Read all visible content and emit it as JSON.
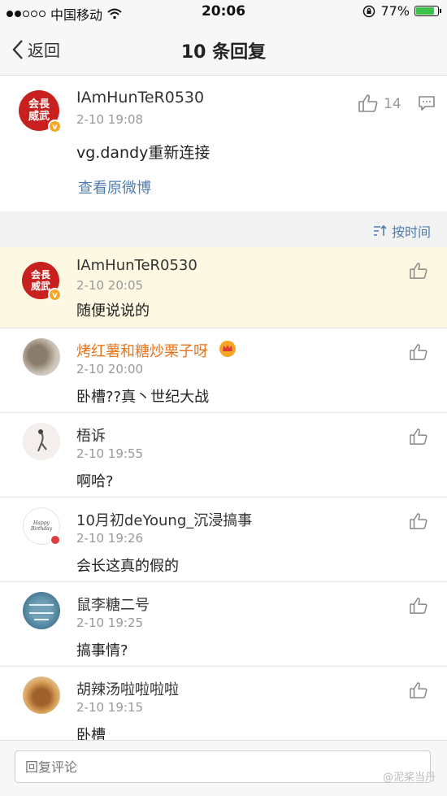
{
  "status_bar": {
    "carrier": "中国移动",
    "time": "20:06",
    "battery": "77%"
  },
  "nav": {
    "back_label": "返回",
    "title": "10 条回复"
  },
  "original": {
    "username": "IAmHunTeR0530",
    "avatar_text_1": "会長",
    "avatar_text_2": "威武",
    "time": "2-10 19:08",
    "text": "vg.dandy重新连接",
    "like_count": "14",
    "view_link": "查看原微博"
  },
  "sort": {
    "label": "按时间"
  },
  "comments": [
    {
      "username": "IAmHunTeR0530",
      "avatar_text_1": "会長",
      "avatar_text_2": "威武",
      "time": "2-10 20:05",
      "text": "随便说说的"
    },
    {
      "username": "烤红薯和糖炒栗子呀",
      "time": "2-10 20:00",
      "text": "卧槽??真丶世纪大战"
    },
    {
      "username": "梧诉",
      "time": "2-10 19:55",
      "text": "啊哈?"
    },
    {
      "username": "10月初deYoung_沉浸搞事",
      "avatar_text": "Happy Birthday",
      "time": "2-10 19:26",
      "text": "会长这真的假的"
    },
    {
      "username": "鼠李糖二号",
      "time": "2-10 19:25",
      "text": "搞事情?"
    },
    {
      "username": "胡辣汤啦啦啦啦",
      "time": "2-10 19:15",
      "text": "卧槽"
    }
  ],
  "reply": {
    "placeholder": "回复评论"
  },
  "watermark": "@泥桨当丹",
  "colors": {
    "link": "#507daf",
    "highlight": "#fdf8e1",
    "vip_name": "#eb7317",
    "avatar_red": "#c8201e"
  }
}
